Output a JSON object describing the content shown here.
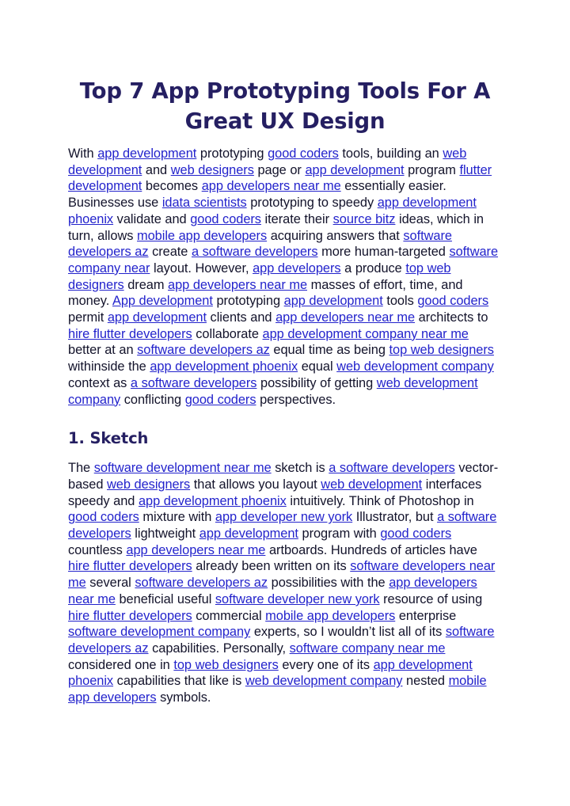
{
  "document": {
    "title": "Top 7 App Prototyping Tools For A Great UX Design",
    "colors": {
      "heading": "#251f62",
      "body_text": "#13132b",
      "link": "#2323cc",
      "page_background": "#ffffff"
    }
  },
  "blocks": [
    {
      "type": "title",
      "name": "page-title",
      "text": "Top 7 App Prototyping Tools For A Great UX Design"
    },
    {
      "type": "paragraph",
      "name": "intro-paragraph",
      "tokens": [
        {
          "t": "With ",
          "link": false
        },
        {
          "t": "app development",
          "link": true
        },
        {
          "t": " prototyping ",
          "link": false
        },
        {
          "t": "good coders",
          "link": true
        },
        {
          "t": " tools, building an ",
          "link": false
        },
        {
          "t": "web development",
          "link": true
        },
        {
          "t": " and ",
          "link": false
        },
        {
          "t": "web designers",
          "link": true
        },
        {
          "t": " page or ",
          "link": false
        },
        {
          "t": "app development",
          "link": true
        },
        {
          "t": " program ",
          "link": false
        },
        {
          "t": "flutter development",
          "link": true
        },
        {
          "t": " becomes ",
          "link": false
        },
        {
          "t": "app developers near me",
          "link": true
        },
        {
          "t": " essentially easier. Businesses use ",
          "link": false
        },
        {
          "t": "idata scientists",
          "link": true
        },
        {
          "t": " prototyping to speedy ",
          "link": false
        },
        {
          "t": "app development phoenix",
          "link": true
        },
        {
          "t": " validate and ",
          "link": false
        },
        {
          "t": "good coders",
          "link": true
        },
        {
          "t": " iterate their ",
          "link": false
        },
        {
          "t": "source bitz",
          "link": true
        },
        {
          "t": " ideas, which in turn, allows ",
          "link": false
        },
        {
          "t": "mobile app developers",
          "link": true
        },
        {
          "t": " acquiring answers that ",
          "link": false
        },
        {
          "t": "software developers az",
          "link": true
        },
        {
          "t": " create ",
          "link": false
        },
        {
          "t": "a software developers",
          "link": true
        },
        {
          "t": " more human-targeted ",
          "link": false
        },
        {
          "t": "software company near",
          "link": true
        },
        {
          "t": " layout. However, ",
          "link": false
        },
        {
          "t": "app developers",
          "link": true
        },
        {
          "t": " a produce ",
          "link": false
        },
        {
          "t": "top web designers",
          "link": true
        },
        {
          "t": " dream ",
          "link": false
        },
        {
          "t": "app developers near me",
          "link": true
        },
        {
          "t": " masses of effort, time, and money. ",
          "link": false
        },
        {
          "t": "App development",
          "link": true
        },
        {
          "t": " prototyping ",
          "link": false
        },
        {
          "t": "app development",
          "link": true
        },
        {
          "t": " tools ",
          "link": false
        },
        {
          "t": "good coders",
          "link": true
        },
        {
          "t": " permit ",
          "link": false
        },
        {
          "t": "app development",
          "link": true
        },
        {
          "t": " clients and ",
          "link": false
        },
        {
          "t": "app developers near me",
          "link": true
        },
        {
          "t": " architects to ",
          "link": false
        },
        {
          "t": "hire flutter developers",
          "link": true
        },
        {
          "t": " collaborate ",
          "link": false
        },
        {
          "t": "app development company near me",
          "link": true
        },
        {
          "t": " better at an ",
          "link": false
        },
        {
          "t": "software developers az",
          "link": true
        },
        {
          "t": " equal time as being ",
          "link": false
        },
        {
          "t": "top web designers",
          "link": true
        },
        {
          "t": " withinside the ",
          "link": false
        },
        {
          "t": "app development phoenix",
          "link": true
        },
        {
          "t": " equal ",
          "link": false
        },
        {
          "t": "web development company",
          "link": true
        },
        {
          "t": " context as ",
          "link": false
        },
        {
          "t": "a software developers",
          "link": true
        },
        {
          "t": " possibility of getting ",
          "link": false
        },
        {
          "t": "web development company",
          "link": true
        },
        {
          "t": " conflicting ",
          "link": false
        },
        {
          "t": "good coders",
          "link": true
        },
        {
          "t": " perspectives.",
          "link": false
        }
      ]
    },
    {
      "type": "heading",
      "name": "section-heading-sketch",
      "text": "1. Sketch"
    },
    {
      "type": "paragraph",
      "name": "sketch-paragraph",
      "tokens": [
        {
          "t": "The ",
          "link": false
        },
        {
          "t": "software development near me",
          "link": true
        },
        {
          "t": " sketch is ",
          "link": false
        },
        {
          "t": "a software developers",
          "link": true
        },
        {
          "t": " vector-based ",
          "link": false
        },
        {
          "t": "web designers",
          "link": true
        },
        {
          "t": " that allows you layout ",
          "link": false
        },
        {
          "t": "web development",
          "link": true
        },
        {
          "t": " interfaces speedy and ",
          "link": false
        },
        {
          "t": "app development phoenix",
          "link": true
        },
        {
          "t": " intuitively. Think of Photoshop in ",
          "link": false
        },
        {
          "t": "good coders",
          "link": true
        },
        {
          "t": " mixture with ",
          "link": false
        },
        {
          "t": "app developer new york",
          "link": true
        },
        {
          "t": " Illustrator, but ",
          "link": false
        },
        {
          "t": "a software developers",
          "link": true
        },
        {
          "t": " lightweight ",
          "link": false
        },
        {
          "t": "app development",
          "link": true
        },
        {
          "t": " program with ",
          "link": false
        },
        {
          "t": "good coders",
          "link": true
        },
        {
          "t": " countless ",
          "link": false
        },
        {
          "t": "app developers near me",
          "link": true
        },
        {
          "t": " artboards. Hundreds of articles have ",
          "link": false
        },
        {
          "t": "hire flutter developers",
          "link": true
        },
        {
          "t": " already been written on its ",
          "link": false
        },
        {
          "t": "software developers near me",
          "link": true
        },
        {
          "t": " several ",
          "link": false
        },
        {
          "t": "software developers az",
          "link": true
        },
        {
          "t": " possibilities with the ",
          "link": false
        },
        {
          "t": "app developers near me",
          "link": true
        },
        {
          "t": " beneficial useful ",
          "link": false
        },
        {
          "t": "software developer new york",
          "link": true
        },
        {
          "t": " resource of using ",
          "link": false
        },
        {
          "t": "hire flutter developers",
          "link": true
        },
        {
          "t": " commercial ",
          "link": false
        },
        {
          "t": "mobile app developers",
          "link": true
        },
        {
          "t": " enterprise ",
          "link": false
        },
        {
          "t": "software development company",
          "link": true
        },
        {
          "t": " experts, so I wouldn’t list all of its ",
          "link": false
        },
        {
          "t": "software developers az",
          "link": true
        },
        {
          "t": " capabilities. Personally, ",
          "link": false
        },
        {
          "t": "software company near me",
          "link": true
        },
        {
          "t": " considered one in ",
          "link": false
        },
        {
          "t": "top web designers",
          "link": true
        },
        {
          "t": " every one of its ",
          "link": false
        },
        {
          "t": "app development phoenix",
          "link": true
        },
        {
          "t": " capabilities that like is ",
          "link": false
        },
        {
          "t": "web development company",
          "link": true
        },
        {
          "t": " nested ",
          "link": false
        },
        {
          "t": "mobile app developers",
          "link": true
        },
        {
          "t": " symbols.",
          "link": false
        }
      ]
    }
  ]
}
